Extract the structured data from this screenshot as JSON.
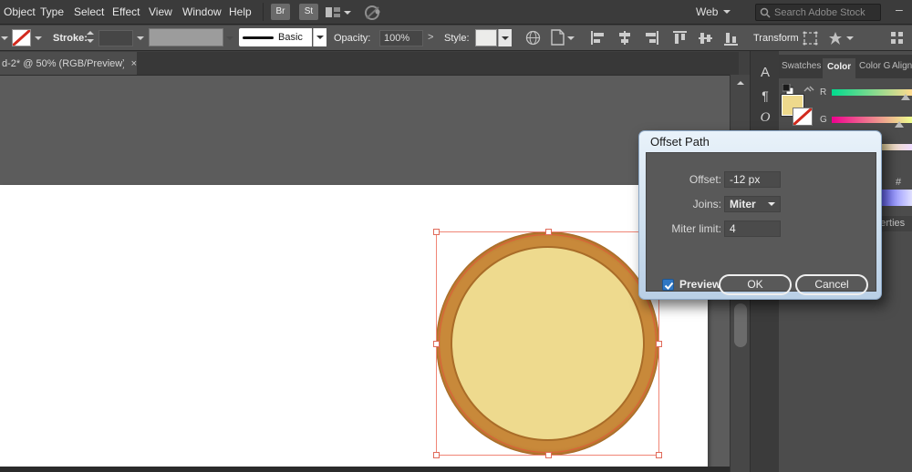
{
  "menubar": {
    "items": [
      "Object",
      "Type",
      "Select",
      "Effect",
      "View",
      "Window",
      "Help"
    ],
    "br_button": "Br",
    "st_button": "St",
    "web_dropdown": "Web",
    "search_placeholder": "Search Adobe Stock",
    "minimize_glyph": "–"
  },
  "controlbar": {
    "stroke_label": "Stroke:",
    "brush_name": "Basic",
    "opacity_label": "Opacity:",
    "opacity_value": "100%",
    "style_label": "Style:",
    "transform_label": "Transform"
  },
  "tabbar": {
    "doc_title": "d-2* @ 50% (RGB/Preview)",
    "close_glyph": "×"
  },
  "dialog": {
    "title": "Offset Path",
    "offset_label": "Offset:",
    "offset_value": "-12 px",
    "joins_label": "Joins:",
    "joins_value": "Miter",
    "miter_label": "Miter limit:",
    "miter_value": "4",
    "preview_label": "Preview",
    "ok_label": "OK",
    "cancel_label": "Cancel"
  },
  "dock": {
    "icons": [
      "A",
      "¶",
      "O"
    ],
    "tabs": [
      "Swatches",
      "Color",
      "Color Guide",
      "Align"
    ],
    "properties_tab": "Properties",
    "r_label": "R",
    "g_label": "G",
    "hex_glyph": "#"
  },
  "colors": {
    "coin_ring": "#c8893a",
    "coin_fill": "#eeda8e",
    "selection_red": "#f08576",
    "checkbox_blue": "#2f77c4",
    "r_slider_gradient": [
      "rgb(0,218,142)",
      "rgb(255,218,142)"
    ],
    "g_slider_gradient": [
      "rgb(238,0,142)",
      "rgb(238,255,142)"
    ],
    "b_slider_gradient": [
      "rgb(238,218,0)",
      "rgb(238,218,255)"
    ]
  }
}
